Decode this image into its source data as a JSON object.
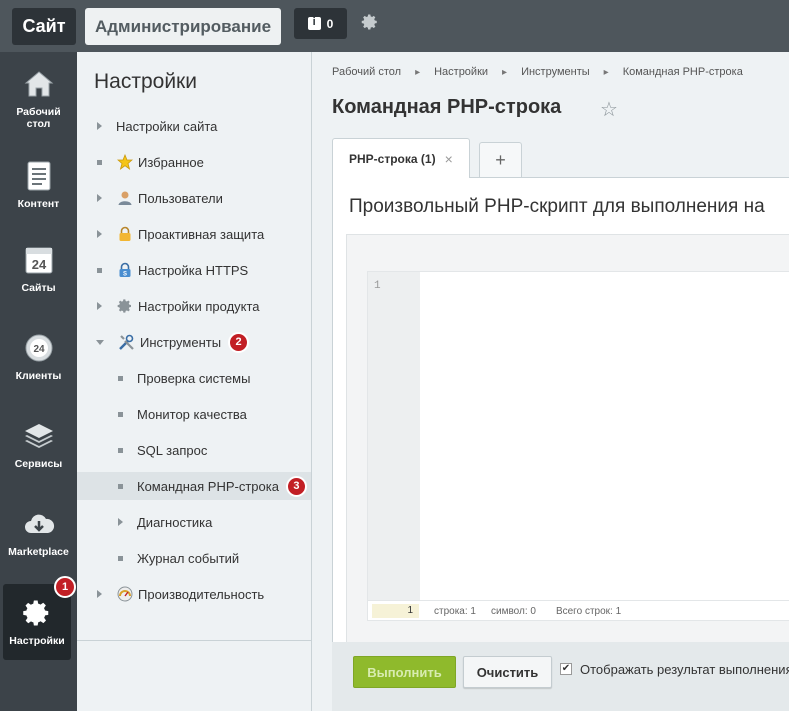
{
  "topbar": {
    "site_label": "Сайт",
    "admin_label": "Администрирование",
    "notifications_count": "0"
  },
  "sidebar": {
    "items": [
      {
        "label": "Рабочий стол",
        "icon": "home-icon"
      },
      {
        "label": "Контент",
        "icon": "document-icon"
      },
      {
        "label": "Сайты",
        "icon": "calendar-24-icon"
      },
      {
        "label": "Клиенты",
        "icon": "clients-24-icon"
      },
      {
        "label": "Сервисы",
        "icon": "layers-icon"
      },
      {
        "label": "Marketplace",
        "icon": "cloud-download-icon"
      },
      {
        "label": "Настройки",
        "icon": "gear-icon",
        "badge": "1"
      }
    ]
  },
  "menu": {
    "title": "Настройки",
    "items": [
      {
        "label": "Настройки сайта"
      },
      {
        "label": "Избранное"
      },
      {
        "label": "Пользователи"
      },
      {
        "label": "Проактивная защита"
      },
      {
        "label": "Настройка HTTPS"
      },
      {
        "label": "Настройки продукта"
      },
      {
        "label": "Инструменты",
        "badge": "2"
      },
      {
        "label": "Проверка системы"
      },
      {
        "label": "Монитор качества"
      },
      {
        "label": "SQL запрос"
      },
      {
        "label": "Командная PHP-строка",
        "badge": "3"
      },
      {
        "label": "Диагностика"
      },
      {
        "label": "Журнал событий"
      },
      {
        "label": "Производительность"
      }
    ]
  },
  "main": {
    "breadcrumb": [
      "Рабочий стол",
      "Настройки",
      "Инструменты",
      "Командная PHP-строка"
    ],
    "title": "Командная PHP-строка",
    "tabs": [
      {
        "label": "PHP-строка (1)"
      }
    ],
    "add_tab": "+",
    "description": "Произвольный PHP-скрипт для выполнения на",
    "editor": {
      "line_number": "1",
      "current_line": "1",
      "status_line": "строка: 1",
      "status_symbol": "символ: 0",
      "status_total": "Всего строк: 1"
    },
    "footer": {
      "run_label": "Выполнить",
      "clear_label": "Очистить",
      "show_result_label": "Отображать результат выполнения",
      "show_result_checked": true
    }
  },
  "colors": {
    "topbar": "#4e565c",
    "sidebar": "#3c4349",
    "run_button": "#8fba2c",
    "badge": "#c21f25"
  }
}
